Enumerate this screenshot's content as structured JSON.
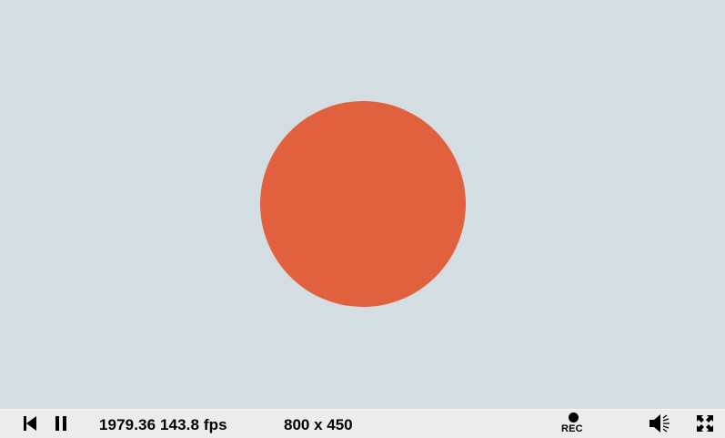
{
  "canvas": {
    "background_color": "#d4dde2",
    "circle_color": "#e1603d"
  },
  "controls": {
    "rewind_icon": "skip-to-start-icon",
    "pause_icon": "pause-icon",
    "time_fps": "1979.36 143.8 fps",
    "resolution": "800 x 450",
    "record_label": "REC",
    "record_icon": "record-dot-icon",
    "volume_icon": "speaker-volume-icon",
    "fullscreen_icon": "fullscreen-icon"
  }
}
